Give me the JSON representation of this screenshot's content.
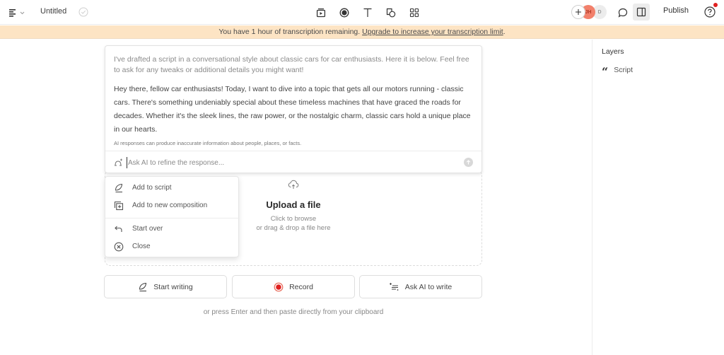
{
  "header": {
    "menu_icon": "document-menu-icon",
    "title": "Untitled",
    "saved_icon": "check-circle-icon",
    "tools": [
      {
        "name": "media-library",
        "icon": "media-play-icon"
      },
      {
        "name": "record",
        "icon": "record-icon"
      },
      {
        "name": "text",
        "icon": "text-icon"
      },
      {
        "name": "shapes",
        "icon": "shapes-icon"
      },
      {
        "name": "grid",
        "icon": "grid-icon"
      }
    ],
    "collaborators": [
      {
        "initials": "JH",
        "color": "#f2806b"
      },
      {
        "initials": "D",
        "color": "#ececec"
      }
    ],
    "publish_label": "Publish",
    "help_icon": "help-icon"
  },
  "banner": {
    "text": "You have 1 hour of transcription remaining.",
    "link": "Upgrade to increase your transcription limit",
    "suffix": ".",
    "bg_color": "#fde4c4"
  },
  "ai_card": {
    "intro": "I've drafted a script in a conversational style about classic cars for car enthusiasts. Here it is below. Feel free to ask for any tweaks or additional details you might want!",
    "body": "Hey there, fellow car enthusiasts! Today, I want to dive into a topic that gets all our motors running - classic cars. There's something undeniably special about these timeless machines that have graced the roads for decades. Whether it's the sleek lines, the raw power, or the nostalgic charm, classic cars hold a unique place in our hearts.",
    "disclaimer": "AI responses can produce inaccurate information about people, places, or facts.",
    "input_placeholder": "Ask AI to refine the response...",
    "input_value": ""
  },
  "action_menu": {
    "items": [
      {
        "label": "Add to script",
        "icon": "pen-icon"
      },
      {
        "label": "Add to new composition",
        "icon": "add-composition-icon"
      },
      {
        "label": "Start over",
        "icon": "undo-arrow-icon"
      },
      {
        "label": "Close",
        "icon": "close-circle-icon"
      }
    ]
  },
  "upload": {
    "title": "Upload a file",
    "line1": "Click to browse",
    "line2": "or drag & drop a file here"
  },
  "buttons": {
    "start_writing": "Start writing",
    "record": "Record",
    "ask_ai": "Ask AI to write",
    "record_color": "#e02020"
  },
  "hint": "or press Enter and then paste directly from your clipboard",
  "layers": {
    "title": "Layers",
    "items": [
      {
        "label": "Script",
        "icon": "quote-icon"
      }
    ]
  }
}
